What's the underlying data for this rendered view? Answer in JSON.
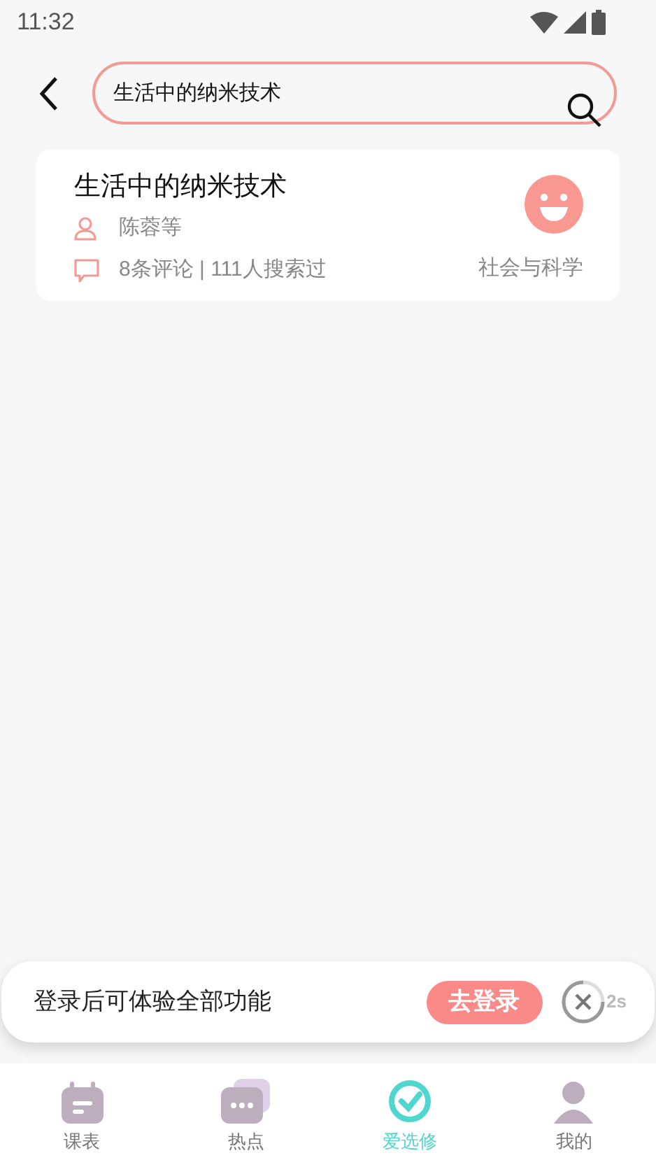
{
  "status_bar": {
    "time": "11:32"
  },
  "search": {
    "value": "生活中的纳米技术"
  },
  "results": [
    {
      "title": "生活中的纳米技术",
      "author": "陈蓉等",
      "stats": "8条评论 | 111人搜索过",
      "category": "社会与科学"
    }
  ],
  "login_banner": {
    "message": "登录后可体验全部功能",
    "button": "去登录",
    "countdown": "2s"
  },
  "tabs": [
    {
      "label": "课表",
      "kind": "schedule",
      "selected": false
    },
    {
      "label": "热点",
      "kind": "hot",
      "selected": false
    },
    {
      "label": "爱选修",
      "kind": "choose",
      "selected": true
    },
    {
      "label": "我的",
      "kind": "me",
      "selected": false
    }
  ]
}
